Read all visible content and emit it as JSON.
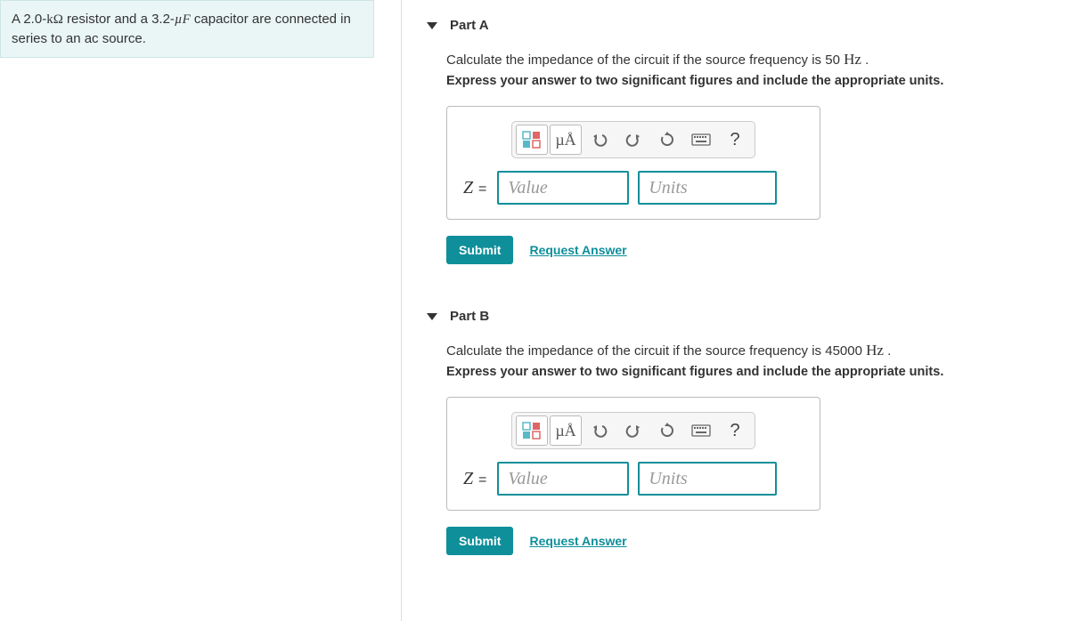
{
  "problem": {
    "text_pre": "A 2.0-",
    "kohm": "kΩ",
    "text_mid": " resistor and a 3.2-",
    "muF": "µF",
    "text_post": " capacitor are connected in series to an ac source."
  },
  "parts": [
    {
      "title": "Part A",
      "prompt_pre": "Calculate the impedance of the circuit if the source frequency is 50 ",
      "prompt_hz": "Hz",
      "prompt_post": " .",
      "hint": "Express your answer to two significant figures and include the appropriate units.",
      "var": "Z",
      "eq": "=",
      "value_placeholder": "Value",
      "units_placeholder": "Units",
      "submit": "Submit",
      "request": "Request Answer",
      "mu_label": "µÅ",
      "help_label": "?"
    },
    {
      "title": "Part B",
      "prompt_pre": "Calculate the impedance of the circuit if the source frequency is 45000 ",
      "prompt_hz": "Hz",
      "prompt_post": " .",
      "hint": "Express your answer to two significant figures and include the appropriate units.",
      "var": "Z",
      "eq": "=",
      "value_placeholder": "Value",
      "units_placeholder": "Units",
      "submit": "Submit",
      "request": "Request Answer",
      "mu_label": "µÅ",
      "help_label": "?"
    }
  ]
}
